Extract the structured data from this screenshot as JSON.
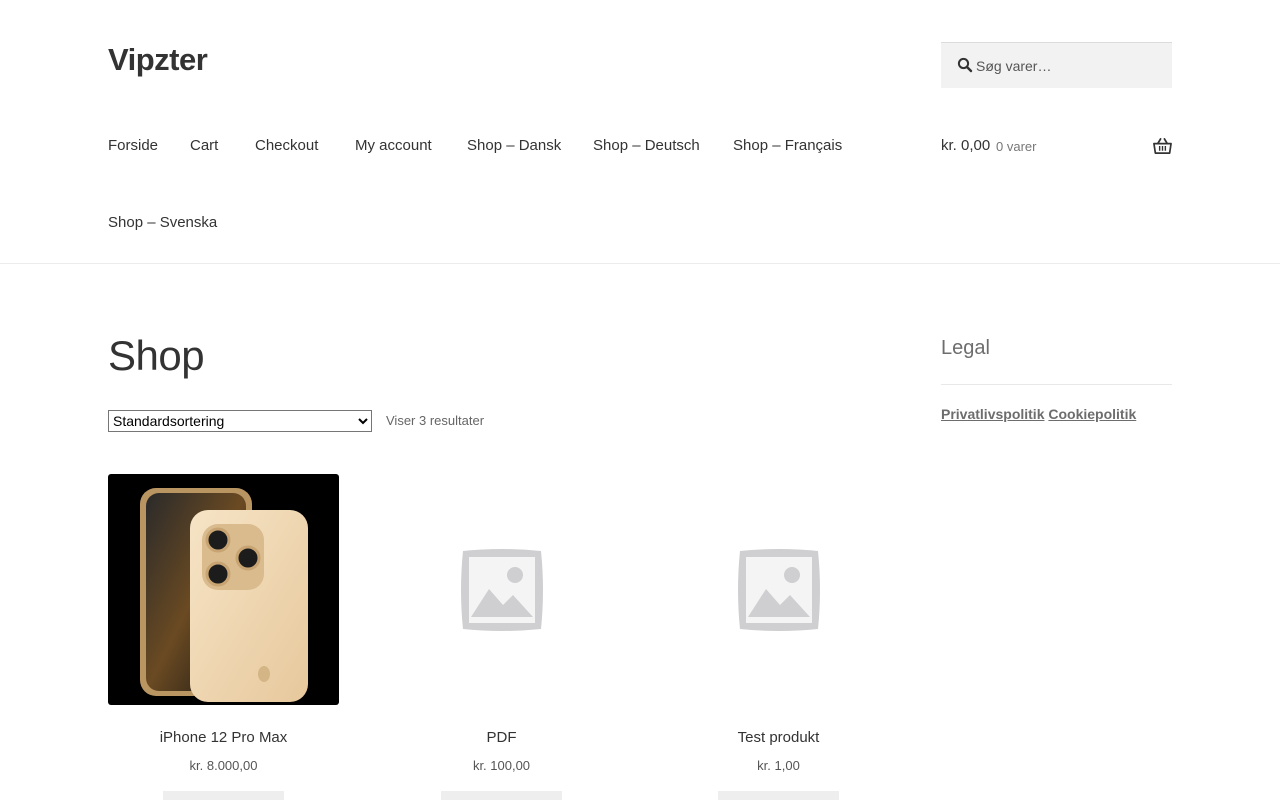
{
  "site": {
    "title": "Vipzter"
  },
  "search": {
    "placeholder": "Søg varer…"
  },
  "nav": {
    "items": [
      {
        "label": "Forside"
      },
      {
        "label": "Cart"
      },
      {
        "label": "Checkout"
      },
      {
        "label": "My account"
      },
      {
        "label": "Shop – Dansk"
      },
      {
        "label": "Shop – Deutsch"
      },
      {
        "label": "Shop – Français"
      },
      {
        "label": "Shop – Svenska"
      }
    ]
  },
  "cart": {
    "amount": "kr. 0,00",
    "count": "0 varer"
  },
  "shop": {
    "title": "Shop",
    "sort_selected": "Standardsortering",
    "result_count": "Viser 3 resultater",
    "products": [
      {
        "name": "iPhone 12 Pro Max",
        "price": "kr. 8.000,00"
      },
      {
        "name": "PDF",
        "price": "kr. 100,00"
      },
      {
        "name": "Test produkt",
        "price": "kr. 1,00"
      }
    ]
  },
  "sidebar": {
    "widget_title": "Legal",
    "links": [
      {
        "label": "Privatlivspolitik"
      },
      {
        "label": "Cookiepolitik"
      }
    ]
  },
  "icons": {
    "search": "search-icon",
    "cart": "basket-icon",
    "placeholder": "image-placeholder-icon"
  }
}
